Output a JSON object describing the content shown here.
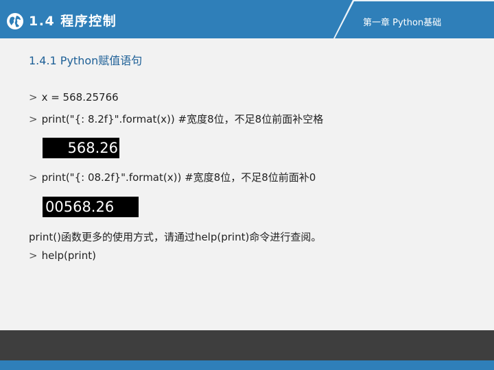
{
  "header": {
    "section_title": "1.4 程序控制",
    "chapter": "第一章 Python基础"
  },
  "subsection_title": "1.4.1 Python赋值语句",
  "lines": {
    "prompt_symbol": ">",
    "l1": "x = 568.25766",
    "l2": "print(\"{: 8.2f}\".format(x))   #宽度8位，不足8位前面补空格",
    "l3": "print(\"{: 08.2f}\".format(x))   #宽度8位，不足8位前面补0",
    "l4": "print()函数更多的使用方式，请通过help(print)命令进行查阅。",
    "l5": "help(print)"
  },
  "outputs": {
    "o1": "568.26",
    "o2": "00568.26"
  },
  "colors": {
    "header_blue": "#2f7fb9",
    "footer_dark": "#3e3e3e",
    "subsection_blue": "#1d5f96"
  },
  "icons": {
    "globe": "globe-icon"
  }
}
